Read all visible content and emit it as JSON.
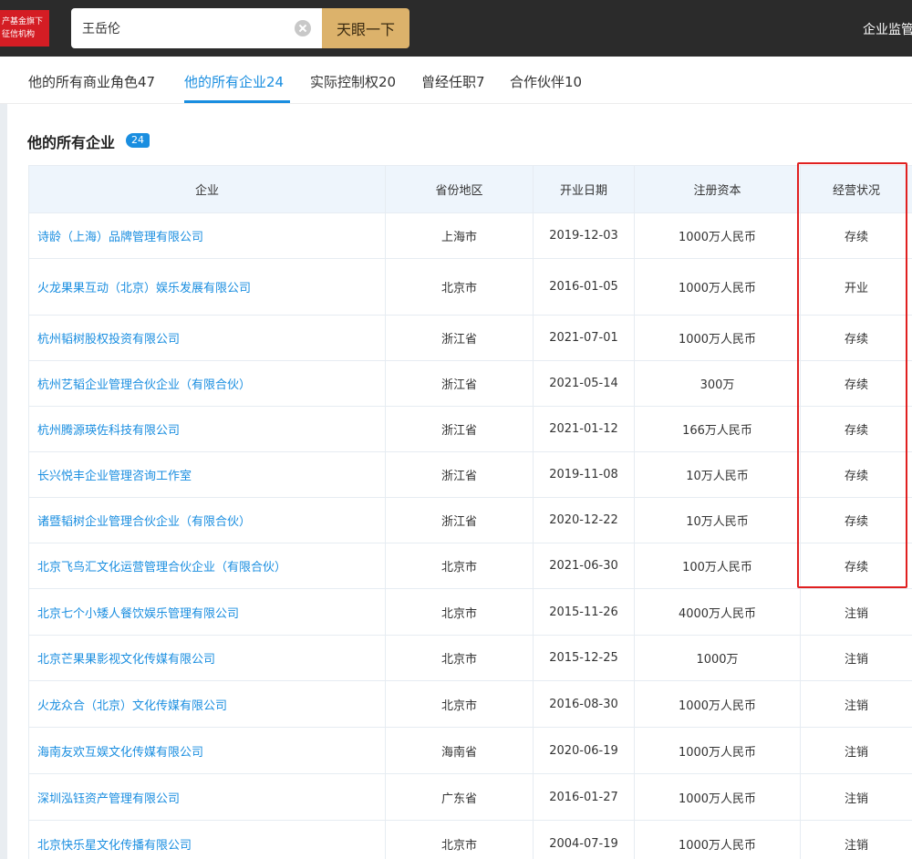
{
  "header": {
    "logo_lines": [
      "产基金旗下",
      "征信机构"
    ],
    "search_value": "王岳伦",
    "search_button": "天眼一下",
    "nav_item": "企业监管"
  },
  "tabs": [
    {
      "label": "他的所有商业角色47"
    },
    {
      "label": "他的所有企业24"
    },
    {
      "label": "实际控制权20"
    },
    {
      "label": "曾经任职7"
    },
    {
      "label": "合作伙伴10"
    }
  ],
  "section": {
    "title": "他的所有企业",
    "count": "24"
  },
  "table": {
    "headers": [
      "企业",
      "省份地区",
      "开业日期",
      "注册资本",
      "经营状况"
    ],
    "rows": [
      {
        "company": "诗龄（上海）品牌管理有限公司",
        "region": "上海市",
        "date": "2019-12-03",
        "capital": "1000万人民币",
        "status": "存续"
      },
      {
        "company": "火龙果果互动（北京）娱乐发展有限公司",
        "region": "北京市",
        "date": "2016-01-05",
        "capital": "1000万人民币",
        "status": "开业"
      },
      {
        "company": "杭州韬树股权投资有限公司",
        "region": "浙江省",
        "date": "2021-07-01",
        "capital": "1000万人民币",
        "status": "存续"
      },
      {
        "company": "杭州艺韬企业管理合伙企业（有限合伙）",
        "region": "浙江省",
        "date": "2021-05-14",
        "capital": "300万",
        "status": "存续"
      },
      {
        "company": "杭州腾源瑛佐科技有限公司",
        "region": "浙江省",
        "date": "2021-01-12",
        "capital": "166万人民币",
        "status": "存续"
      },
      {
        "company": "长兴悦丰企业管理咨询工作室",
        "region": "浙江省",
        "date": "2019-11-08",
        "capital": "10万人民币",
        "status": "存续"
      },
      {
        "company": "诸暨韬树企业管理合伙企业（有限合伙）",
        "region": "浙江省",
        "date": "2020-12-22",
        "capital": "10万人民币",
        "status": "存续"
      },
      {
        "company": "北京飞鸟汇文化运营管理合伙企业（有限合伙）",
        "region": "北京市",
        "date": "2021-06-30",
        "capital": "100万人民币",
        "status": "存续"
      },
      {
        "company": "北京七个小矮人餐饮娱乐管理有限公司",
        "region": "北京市",
        "date": "2015-11-26",
        "capital": "4000万人民币",
        "status": "注销"
      },
      {
        "company": "北京芒果果影视文化传媒有限公司",
        "region": "北京市",
        "date": "2015-12-25",
        "capital": "1000万",
        "status": "注销"
      },
      {
        "company": "火龙众合（北京）文化传媒有限公司",
        "region": "北京市",
        "date": "2016-08-30",
        "capital": "1000万人民币",
        "status": "注销"
      },
      {
        "company": "海南友欢互娱文化传媒有限公司",
        "region": "海南省",
        "date": "2020-06-19",
        "capital": "1000万人民币",
        "status": "注销"
      },
      {
        "company": "深圳泓钰资产管理有限公司",
        "region": "广东省",
        "date": "2016-01-27",
        "capital": "1000万人民币",
        "status": "注销"
      },
      {
        "company": "北京快乐星文化传播有限公司",
        "region": "北京市",
        "date": "2004-07-19",
        "capital": "1000万人民币",
        "status": "注销"
      }
    ]
  },
  "colors": {
    "accent_blue": "#1a8ee0",
    "search_button": "#dcb26b",
    "highlight_red": "#e02020",
    "topbar": "#2b2b2b",
    "logo_red": "#d41d24"
  }
}
